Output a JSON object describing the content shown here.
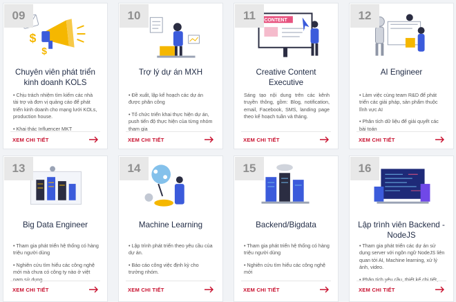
{
  "cards": [
    {
      "number": "09",
      "title": "Chuyên viên phát triển kinh doanh KOLS",
      "bullets": [
        "• Chịu trách nhiệm tìm kiếm các nhà tài trợ và đơn vị quảng cáo để phát triển kinh doanh cho mạng lưới KOLs, production house.",
        "• Khai thác Influencer MKT"
      ],
      "more": "XEM CHI TIẾT"
    },
    {
      "number": "10",
      "title": "Trợ lý dự án MXH",
      "bullets": [
        "• Đề xuất, lập kế hoạch các dự án được phân công",
        "• Tổ chức triển khai thực hiện dự án, push tiến độ thực hiện của từng nhóm tham gia"
      ],
      "more": "XEM CHI TIẾT"
    },
    {
      "number": "11",
      "title": "Creative Content Executive",
      "bullets": [
        "Sáng tạo nội dung trên các kênh truyền thông, gồm: Blog, notification, email, Facebook, SMS, landing page theo kế hoạch tuần và tháng."
      ],
      "more": "XEM CHI TIẾT",
      "illus_text": "CONTENT"
    },
    {
      "number": "12",
      "title": "AI Engineer",
      "bullets": [
        "• Làm việc cùng team R&D để phát triển các giải pháp, sản phẩm thuộc lĩnh vực AI",
        "• Phân tích dữ liệu để giải quyết các bài toán"
      ],
      "more": "XEM CHI TIẾT"
    },
    {
      "number": "13",
      "title": "Big Data Engineer",
      "bullets": [
        "• Tham gia phát triển hệ thống có hàng triệu người dùng",
        "• Nghiên cứu tìm hiểu các công nghệ mới mà chưa có công ty nào ở việt nam sử dụng"
      ],
      "more": "XEM CHI TIẾT"
    },
    {
      "number": "14",
      "title": "Machine Learning",
      "bullets": [
        "• Lập trình phát triển theo yêu cầu của dự án.",
        "• Báo cáo công việc định kỳ cho trưởng nhóm."
      ],
      "more": "XEM CHI TIẾT"
    },
    {
      "number": "15",
      "title": "Backend/Bigdata",
      "bullets": [
        "• Tham gia phát triển hệ thống có hàng triệu người dùng",
        "• Nghiên cứu tìm hiểu các công nghệ mới"
      ],
      "more": "XEM CHI TIẾT"
    },
    {
      "number": "16",
      "title": "Lập trình viên Backend - NodeJS",
      "bullets": [
        "• Tham gia phát triển các dự án sử dụng server với ngôn ngữ NodeJS liên quan tới AI, Machine learning, xử lý ảnh, video.",
        "• Phân tích yêu cầu, thiết kế chi tiết,"
      ],
      "more": "XEM CHI TIẾT"
    }
  ],
  "colors": {
    "accent": "#c8102e",
    "title": "#1f2a44",
    "badge_bg": "#e8e8e8",
    "illus_blue": "#3b5bdb",
    "illus_yellow": "#f5b700"
  }
}
